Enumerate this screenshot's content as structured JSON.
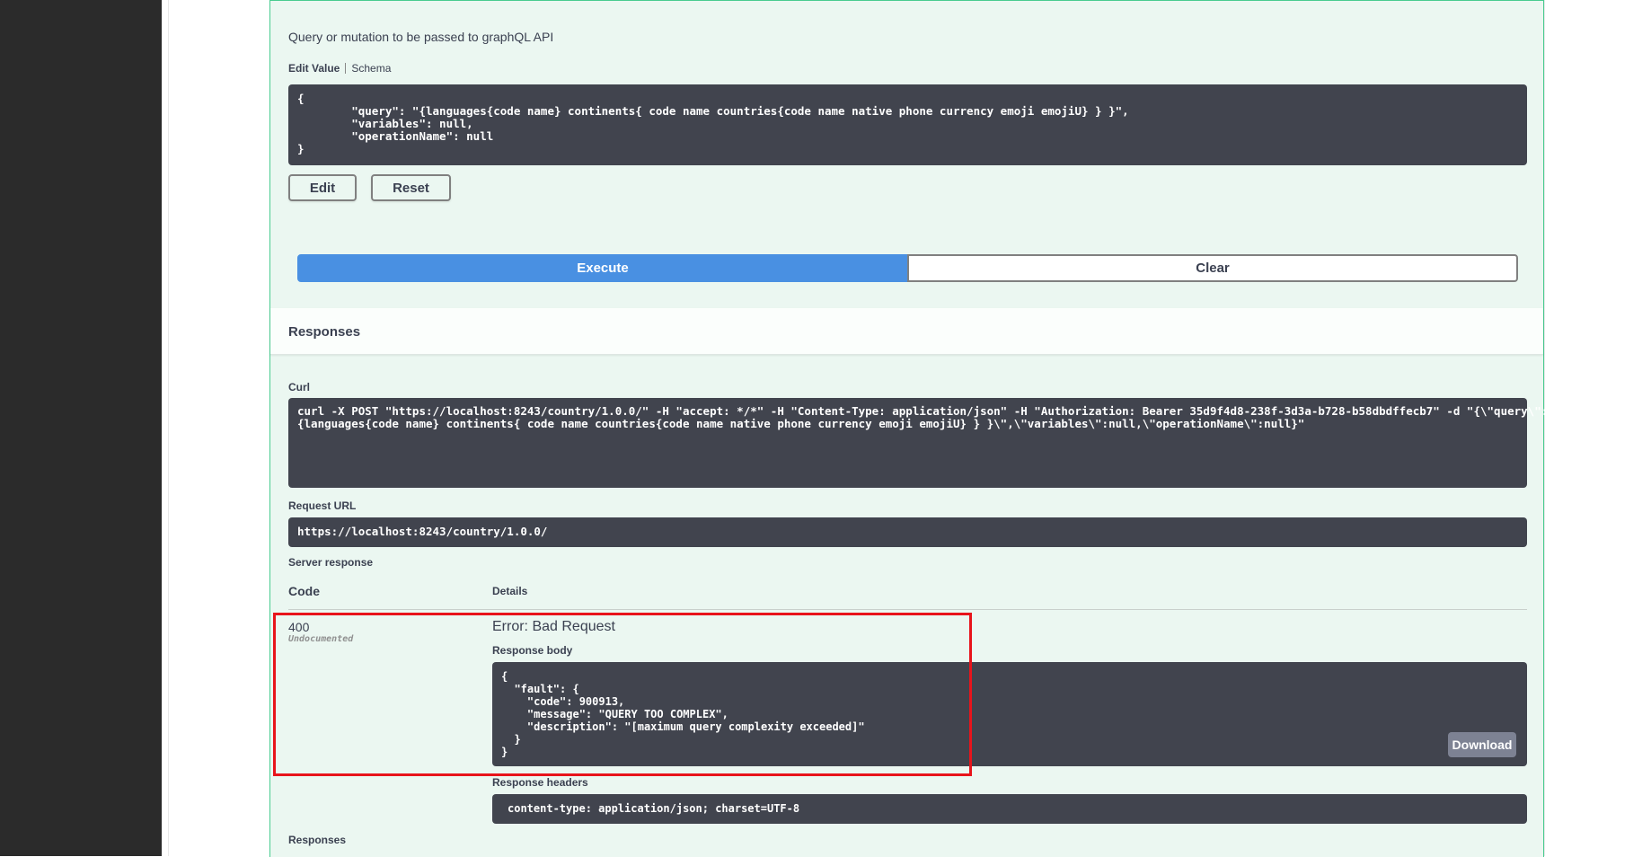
{
  "parameter": {
    "description": "Query or mutation to be passed to graphQL API",
    "tabs": {
      "edit_value": "Edit Value",
      "schema": "Schema"
    },
    "value_lines": [
      "{",
      "        \"query\": \"{languages{code name} continents{ code name countries{code name native phone currency emoji emojiU} } }\",",
      "        \"variables\": null,",
      "        \"operationName\": null",
      "}"
    ],
    "edit_label": "Edit",
    "reset_label": "Reset"
  },
  "actions": {
    "execute_label": "Execute",
    "clear_label": "Clear"
  },
  "responses_section": {
    "title": "Responses"
  },
  "curl": {
    "label": "Curl",
    "lines": [
      "curl -X POST \"https://localhost:8243/country/1.0.0/\" -H \"accept: */*\" -H \"Content-Type: application/json\" -H \"Authorization: Bearer 35d9f4d8-238f-3d3a-b728-b58dbdffecb7\" -d \"{\\\"query\\\":\\\"",
      "{languages{code name} continents{ code name countries{code name native phone currency emoji emojiU} } }\\\",\\\"variables\\\":null,\\\"operationName\\\":null}\""
    ]
  },
  "request_url": {
    "label": "Request URL",
    "value": "https://localhost:8243/country/1.0.0/"
  },
  "server_response": {
    "label": "Server response",
    "code_header": "Code",
    "details_header": "Details",
    "code": "400",
    "code_note": "Undocumented",
    "error_title": "Error: Bad Request",
    "response_body_label": "Response body",
    "response_body_lines": [
      "{",
      "  \"fault\": {",
      "    \"code\": 900913,",
      "    \"message\": \"QUERY TOO COMPLEX\",",
      "    \"description\": \"[maximum query complexity exceeded]\"",
      "  }",
      "}"
    ],
    "download_label": "Download",
    "response_headers_label": "Response headers",
    "response_headers_value": "content-type: application/json; charset=UTF-8"
  },
  "responses_footer": {
    "title": "Responses"
  },
  "colors": {
    "execute_blue": "#4990e2",
    "opblock_bg": "#ebf7f1",
    "opblock_border": "#49cc90",
    "code_bg": "#41444e",
    "highlight_red": "#e8141b",
    "left_bar": "#2b2b2b"
  }
}
